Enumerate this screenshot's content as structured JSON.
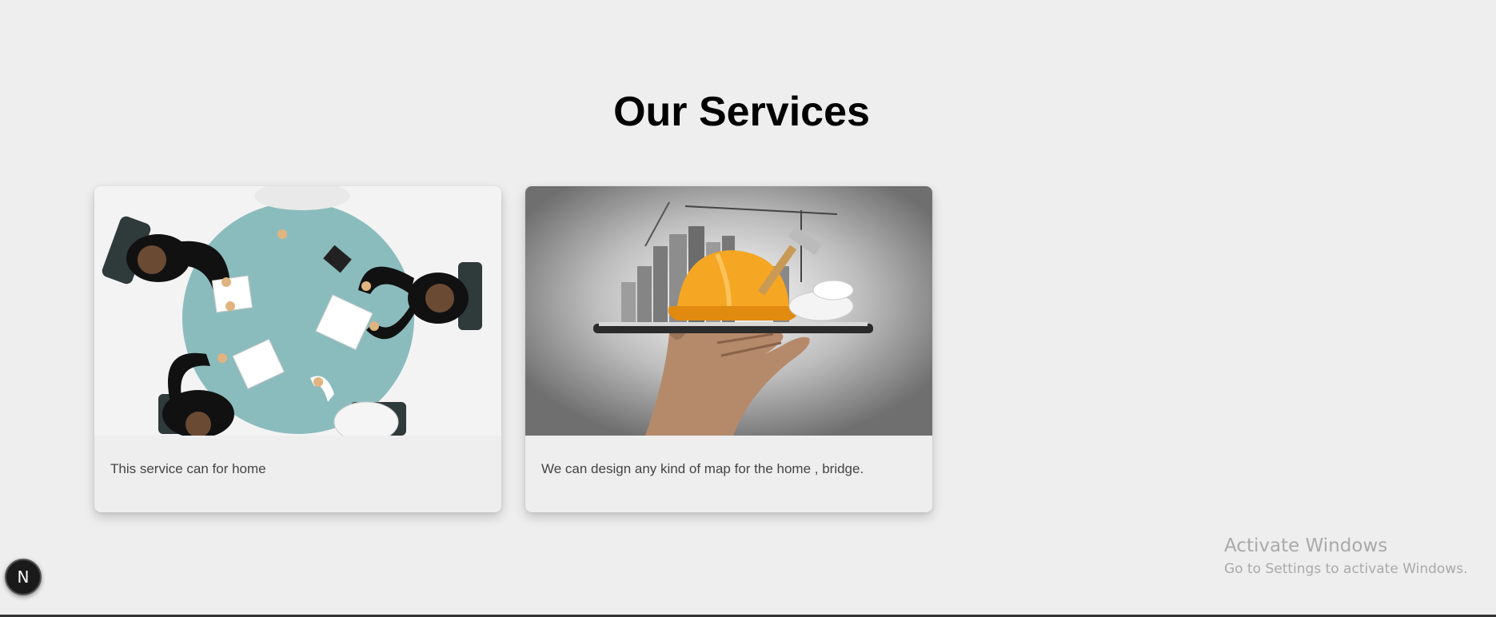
{
  "heading": "Our Services",
  "services": [
    {
      "text": "This service can for home",
      "image": "meeting-table-illustration"
    },
    {
      "text": "We can design any kind of map for the home , bridge.",
      "image": "construction-helmet-city-on-tablet"
    }
  ],
  "watermark": {
    "title": "Activate Windows",
    "subtitle": "Go to Settings to activate Windows."
  },
  "dev_badge": {
    "label": "N",
    "icon": "nextjs-icon"
  },
  "colors": {
    "background": "#eeeeee",
    "helmet": "#f5a623",
    "table": "#8bbcbd"
  }
}
